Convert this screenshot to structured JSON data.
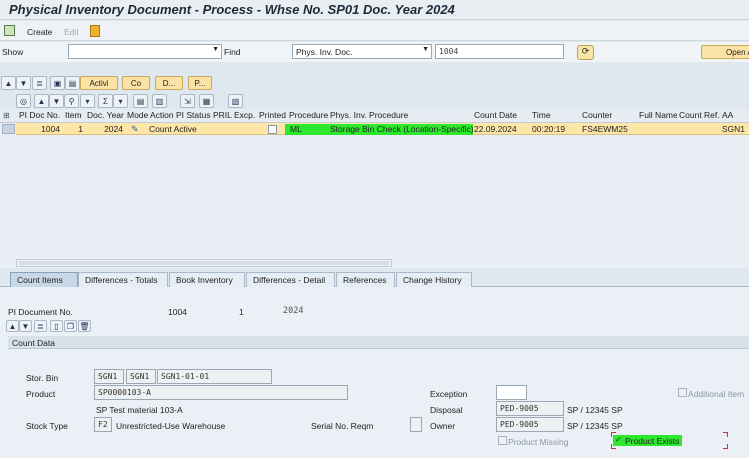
{
  "title": "Physical Inventory Document - Process - Whse No. SP01 Doc. Year 2024",
  "toolbar": {
    "create": "Create",
    "edit": "Edit"
  },
  "search": {
    "show_label": "Show",
    "show_value": "",
    "find_label": "Find",
    "find_value": "Phys. Inv. Doc.",
    "find_input": "1004",
    "open_button": "Open A"
  },
  "actions": {
    "activate": "Activi",
    "count": "Co",
    "delete": "D...",
    "print": "P..."
  },
  "table": {
    "columns": [
      "PI Doc No.",
      "Item",
      "Doc. Year",
      "Mode",
      "Action",
      "PI Status",
      "PRIL Excp.",
      "Printed",
      "Procedure",
      "Phys. Inv. Procedure",
      "Count Date",
      "Time",
      "Counter",
      "Full Name",
      "Count Ref.",
      "AA"
    ],
    "rows": [
      {
        "doc_no": "1004",
        "item": "1",
        "doc_year": "2024",
        "status": "Count Active",
        "procedure": "ML",
        "phys_inv_procedure": "Storage Bin Check (Location-Specific)",
        "count_date": "22.09.2024",
        "time": "00:20:19",
        "counter": "FS4EWM25",
        "full_name": "",
        "count_ref": "",
        "aa": "SGN1"
      }
    ]
  },
  "tabs": [
    "Count Items",
    "Differences - Totals",
    "Book Inventory",
    "Differences - Detail",
    "References",
    "Change History"
  ],
  "detail": {
    "pi_doc_label": "PI Document No.",
    "pi_doc": "1004",
    "item": "1",
    "year": "2024",
    "section": "Count Data",
    "stor_bin_label": "Stor. Bin",
    "bin1": "SGN1",
    "bin2": "SGN1",
    "bin3": "SGN1-01-01",
    "product_label": "Product",
    "product": "SP0000103-A",
    "product_desc": "SP Test material 103-A",
    "stock_type_label": "Stock Type",
    "stock_type": "F2",
    "stock_type_desc": "Unrestricted-Use Warehouse",
    "serial_label": "Serial No. Reqm",
    "exception_label": "Exception",
    "disposal_label": "Disposal",
    "disposal": "PED-9005",
    "disposal_desc": "SP / 12345 SP",
    "owner_label": "Owner",
    "owner": "PED-9005",
    "owner_desc": "SP / 12345 SP",
    "additional_item": "Additional Item",
    "product_missing": "Product Missing",
    "product_exists": "Product Exists"
  }
}
